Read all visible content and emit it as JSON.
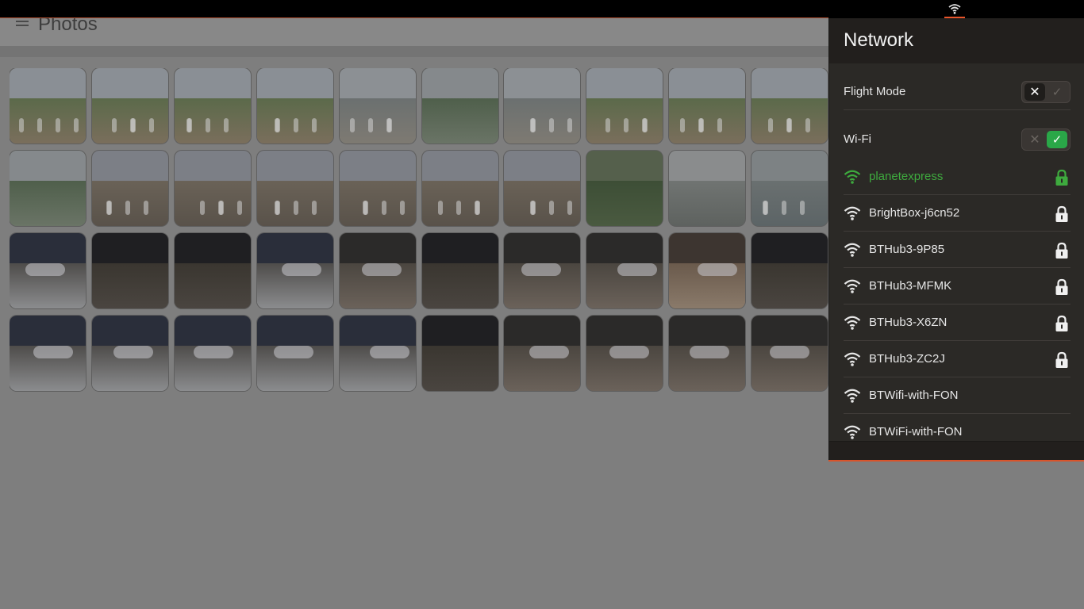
{
  "app": {
    "title": "Photos",
    "menu_icon": "hamburger-icon"
  },
  "status_bar": {
    "network_indicator_icon": "wifi-icon",
    "accent_color": "#e8542a"
  },
  "network_panel": {
    "title": "Network",
    "flight_mode": {
      "label": "Flight Mode",
      "enabled": false
    },
    "wifi": {
      "label": "Wi-Fi",
      "enabled": true
    },
    "networks": [
      {
        "ssid": "planetexpress",
        "secured": true,
        "connected": true
      },
      {
        "ssid": "BrightBox-j6cn52",
        "secured": true,
        "connected": false
      },
      {
        "ssid": "BTHub3-9P85",
        "secured": true,
        "connected": false
      },
      {
        "ssid": "BTHub3-MFMK",
        "secured": true,
        "connected": false
      },
      {
        "ssid": "BTHub3-X6ZN",
        "secured": true,
        "connected": false
      },
      {
        "ssid": "BTHub3-ZC2J",
        "secured": true,
        "connected": false
      },
      {
        "ssid": "BTWifi-with-FON",
        "secured": false,
        "connected": false
      },
      {
        "ssid": "BTWiFi-with-FON",
        "secured": false,
        "connected": false
      }
    ],
    "colors": {
      "connected": "#3eaa3e",
      "switch_on": "#2aa748"
    }
  },
  "photos": {
    "count": 40,
    "scenes": [
      "great-wall",
      "great-wall",
      "great-wall",
      "great-wall",
      "great-wall-mist",
      "mountain-mist",
      "great-wall-mist",
      "great-wall",
      "great-wall",
      "great-wall",
      "mountain-mist",
      "great-wall-group",
      "great-wall-group",
      "great-wall-group",
      "great-wall-group",
      "great-wall-group",
      "great-wall-group",
      "forest",
      "cable-car",
      "museum-wall",
      "space-shuttle",
      "hangar",
      "hangar",
      "space-shuttle",
      "aircraft",
      "hangar",
      "aircraft",
      "aircraft",
      "engine",
      "hangar",
      "space-shuttle",
      "space-shuttle",
      "space-shuttle",
      "space-shuttle",
      "space-shuttle",
      "hangar",
      "aircraft",
      "aircraft",
      "aircraft",
      "aircraft"
    ]
  }
}
